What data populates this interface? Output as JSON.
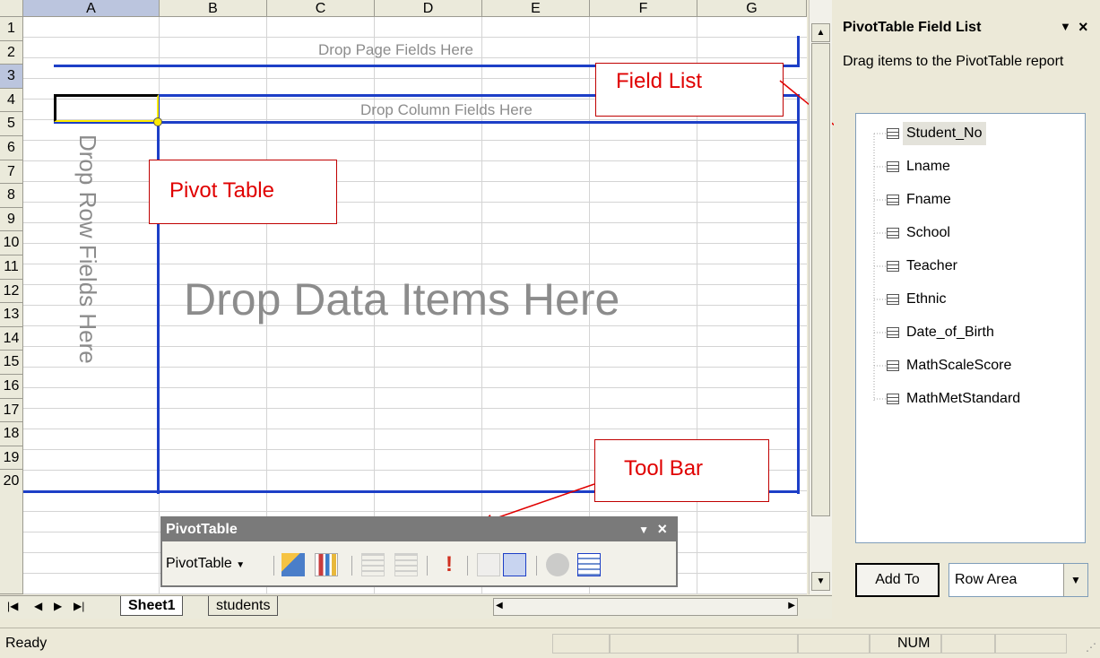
{
  "sheet": {
    "columns": [
      "A",
      "B",
      "C",
      "D",
      "E",
      "F",
      "G"
    ],
    "rows": [
      "1",
      "2",
      "3",
      "4",
      "5",
      "6",
      "7",
      "8",
      "9",
      "10",
      "11",
      "12",
      "13",
      "14",
      "15",
      "16",
      "17",
      "18",
      "19",
      "20"
    ],
    "drop_page": "Drop Page Fields Here",
    "drop_column": "Drop Column Fields Here",
    "drop_row": "Drop Row Fields Here",
    "drop_data": "Drop Data Items Here"
  },
  "callouts": {
    "field_list": "Field List",
    "pivot_table": "Pivot Table",
    "tool_bar": "Tool Bar"
  },
  "tabs": {
    "active": "Sheet1",
    "other": "students"
  },
  "status": {
    "ready": "Ready",
    "num": "NUM"
  },
  "field_pane": {
    "title": "PivotTable Field List",
    "instruction": "Drag items to the PivotTable report",
    "fields": [
      "Student_No",
      "Lname",
      "Fname",
      "School",
      "Teacher",
      "Ethnic",
      "Date_of_Birth",
      "MathScaleScore",
      "MathMetStandard"
    ],
    "add_to_label": "Add To",
    "area_value": "Row Area"
  },
  "toolbar": {
    "title": "PivotTable",
    "menu_label": "PivotTable"
  },
  "colors": {
    "pivot_border": "#1d3fc7",
    "callout_text": "#e00000",
    "selection_border": "#ffeb00"
  }
}
